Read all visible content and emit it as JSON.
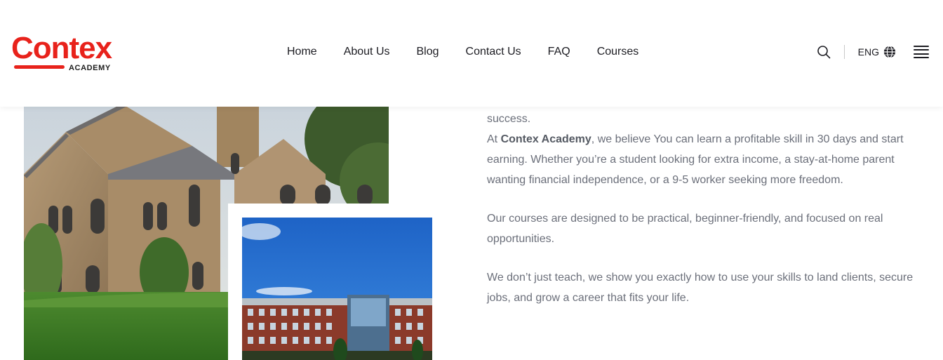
{
  "brand": {
    "name": "Contex",
    "tagline": "ACADEMY",
    "color": "#e8221b"
  },
  "nav": {
    "items": [
      "Home",
      "About Us",
      "Blog",
      "Contact Us",
      "FAQ",
      "Courses"
    ]
  },
  "tools": {
    "search_icon": "search-icon",
    "language": "ENG",
    "language_icon": "globe-icon",
    "menu_icon": "hamburger-icon"
  },
  "about": {
    "lead_fragment": "success.",
    "p1_prefix": "At ",
    "p1_brand": "Contex Academy",
    "p1_rest": ", we believe You can learn a profitable skill in 30 days and start earning. Whether you’re a student looking for extra income, a stay-at-home parent wanting financial independence, or a 9-5 worker seeking more freedom.",
    "p2": "Our courses are designed to be practical, beginner-friendly, and focused on real opportunities.",
    "p3": "We don’t just teach, we show you exactly how to use your skills to land clients, secure jobs, and grow a career that fits your life."
  },
  "images": {
    "main_alt": "campus-stone-building-photo",
    "secondary_alt": "campus-brick-building-photo"
  }
}
